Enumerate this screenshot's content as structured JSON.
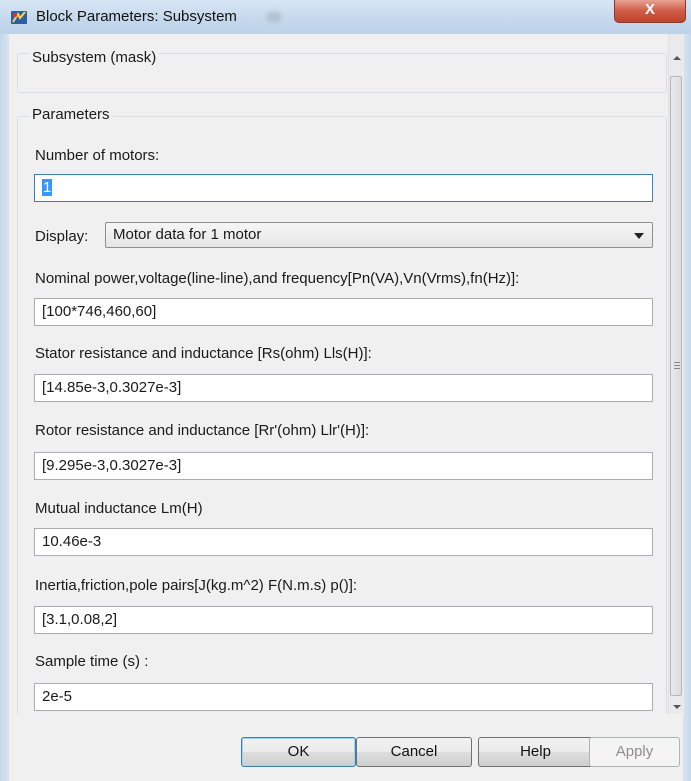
{
  "window": {
    "title": "Block Parameters: Subsystem",
    "close_label": "X"
  },
  "mask_group": {
    "title": "Subsystem (mask)"
  },
  "params_group": {
    "title": "Parameters"
  },
  "params": {
    "num_motors": {
      "label": "Number of motors:",
      "value": "1"
    },
    "display": {
      "label": "Display:",
      "value": "Motor data for 1 motor"
    },
    "nominal": {
      "label": "Nominal power,voltage(line-line),and frequency[Pn(VA),Vn(Vrms),fn(Hz)]:",
      "value": "[100*746,460,60]"
    },
    "stator": {
      "label": "Stator resistance and inductance [Rs(ohm) Lls(H)]:",
      "value": "[14.85e-3,0.3027e-3]"
    },
    "rotor": {
      "label": "Rotor resistance and inductance [Rr'(ohm) Llr'(H)]:",
      "value": "[9.295e-3,0.3027e-3]"
    },
    "mutual": {
      "label": "Mutual inductance Lm(H)",
      "value": "10.46e-3"
    },
    "inertia": {
      "label": "Inertia,friction,pole pairs[J(kg.m^2) F(N.m.s) p()]:",
      "value": "[3.1,0.08,2]"
    },
    "sample": {
      "label": "Sample time (s) :",
      "value": "2e-5"
    }
  },
  "buttons": {
    "ok": "OK",
    "cancel": "Cancel",
    "help": "Help",
    "apply": "Apply"
  },
  "icons": {
    "app": "simulink-icon",
    "dropdown": "chevron-down-icon"
  },
  "colors": {
    "selection": "#3399ff",
    "close_button": "#c1432d",
    "focus_border": "#3c7fb1"
  }
}
